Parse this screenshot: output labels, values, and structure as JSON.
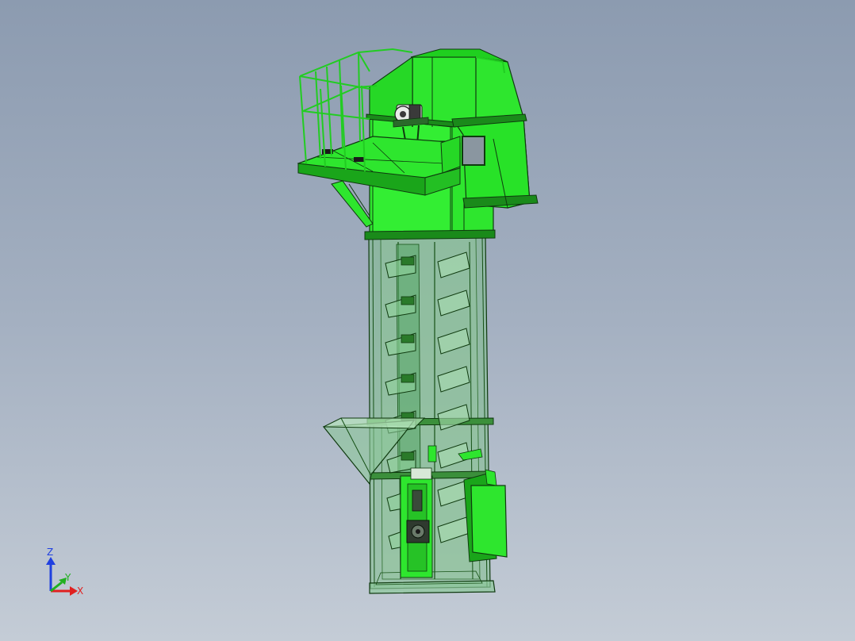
{
  "viewport": {
    "model": "bucket-elevator-assembly",
    "background_top": "#8c9bb0",
    "background_bottom": "#c4ccd6"
  },
  "colors": {
    "body_green": "#2ee62e",
    "dark_green": "#1aa51a",
    "glass_green": "#7fbf8c",
    "edge": "#0f3a0f",
    "axis_x": "#e02020",
    "axis_y": "#20b020",
    "axis_z": "#2040e0"
  },
  "triad": {
    "x_label": "X",
    "y_label": "Y",
    "z_label": "Z"
  }
}
